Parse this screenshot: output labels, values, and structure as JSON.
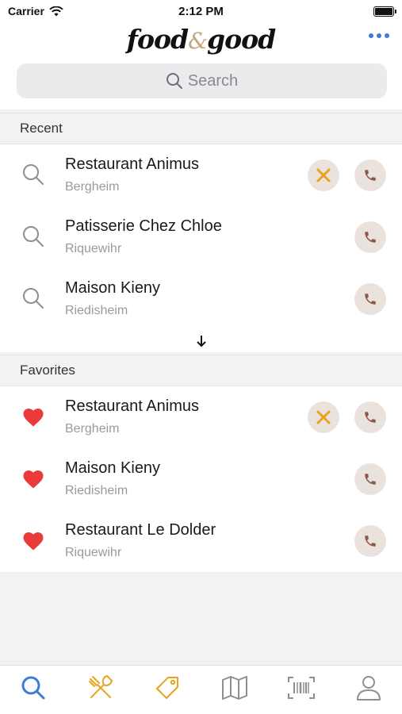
{
  "status_bar": {
    "carrier": "Carrier",
    "time": "2:12 PM"
  },
  "header": {
    "logo_part1": "food",
    "logo_amp": "&",
    "logo_part2": "good",
    "more_icon": "ellipsis-icon"
  },
  "search": {
    "placeholder": "Search"
  },
  "recent": {
    "title": "Recent",
    "items": [
      {
        "name": "Restaurant Animus",
        "city": "Bergheim",
        "has_menu": true
      },
      {
        "name": "Patisserie Chez Chloe",
        "city": "Riquewihr",
        "has_menu": false
      },
      {
        "name": "Maison Kieny",
        "city": "Riedisheim",
        "has_menu": false
      }
    ]
  },
  "favorites": {
    "title": "Favorites",
    "items": [
      {
        "name": "Restaurant Animus",
        "city": "Bergheim",
        "has_menu": true
      },
      {
        "name": "Maison Kieny",
        "city": "Riedisheim",
        "has_menu": false
      },
      {
        "name": "Restaurant Le Dolder",
        "city": "Riquewihr",
        "has_menu": false
      }
    ]
  },
  "tabs": [
    {
      "icon": "search-icon",
      "active": true
    },
    {
      "icon": "fork-knife-icon",
      "active": false
    },
    {
      "icon": "tag-icon",
      "active": false
    },
    {
      "icon": "map-icon",
      "active": false
    },
    {
      "icon": "barcode-icon",
      "active": false
    },
    {
      "icon": "profile-icon",
      "active": false
    }
  ],
  "colors": {
    "accent_blue": "#3f7ad9",
    "accent_orange": "#e8a21c",
    "phone_brown": "#8a5a44",
    "heart_red": "#ea3a3a",
    "button_bg": "#eae3dd"
  }
}
